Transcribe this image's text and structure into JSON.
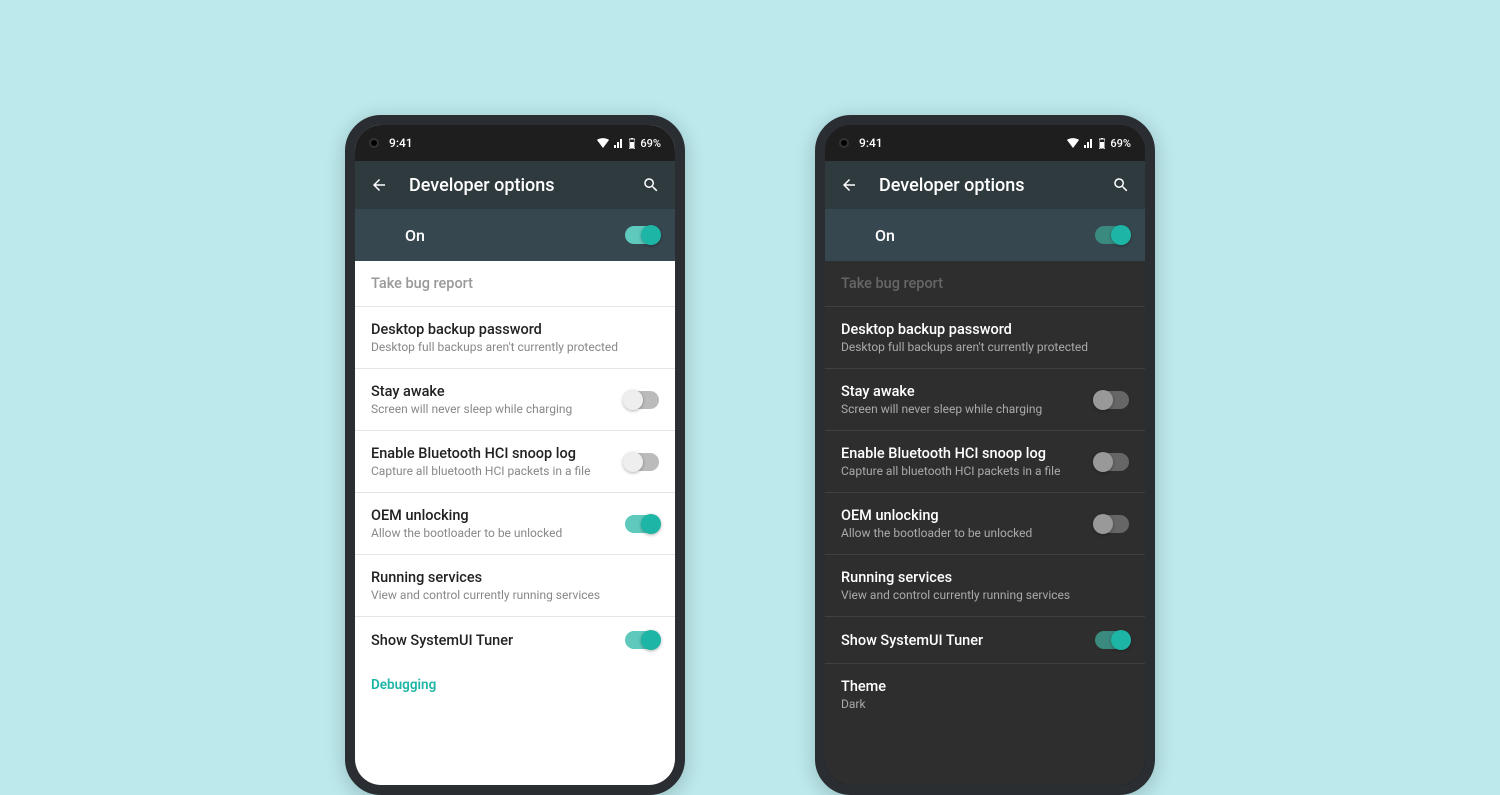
{
  "status": {
    "time": "9:41",
    "battery": "69%"
  },
  "appbar": {
    "title": "Developer options"
  },
  "master": {
    "label": "On",
    "on": true
  },
  "rows": {
    "bugreport": {
      "title": "Take bug report"
    },
    "backup": {
      "title": "Desktop backup password",
      "sub": "Desktop full backups aren't currently protected"
    },
    "stayawake": {
      "title": "Stay awake",
      "sub": "Screen will never sleep while charging",
      "on": false
    },
    "hci": {
      "title": "Enable Bluetooth HCI snoop log",
      "sub": "Capture all bluetooth HCI packets in a file",
      "on": false
    },
    "oem_light": {
      "title": "OEM unlocking",
      "sub": "Allow the bootloader to be unlocked",
      "on": true
    },
    "oem_dark": {
      "title": "OEM unlocking",
      "sub": "Allow the bootloader to be unlocked",
      "on": false
    },
    "running": {
      "title": "Running services",
      "sub": "View and control currently running services"
    },
    "tuner": {
      "title": "Show SystemUI Tuner",
      "on": true
    },
    "theme": {
      "title": "Theme",
      "sub": "Dark"
    }
  },
  "section": {
    "debugging": "Debugging"
  }
}
